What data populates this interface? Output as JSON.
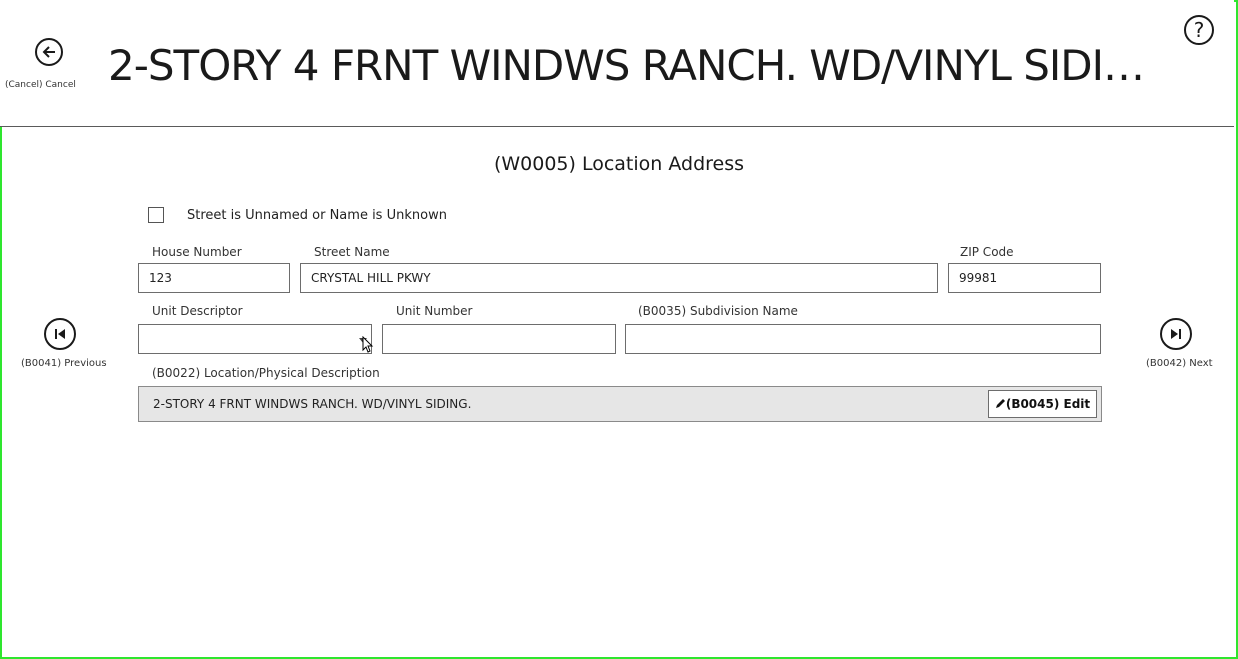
{
  "header": {
    "title": "2-STORY 4 FRNT WINDWS RANCH. WD/VINYL SIDI…",
    "cancel_label": "(Cancel) Cancel",
    "help_label": "?"
  },
  "form": {
    "section_title": "(W0005) Location Address",
    "unnamed_street": {
      "label": "Street is Unnamed or Name is Unknown",
      "checked": false
    },
    "house_number": {
      "label": "House Number",
      "value": "123"
    },
    "street_name": {
      "label": "Street Name",
      "value": "CRYSTAL HILL PKWY"
    },
    "zip_code": {
      "label": "ZIP Code",
      "value": "99981"
    },
    "unit_descriptor": {
      "label": "Unit Descriptor",
      "value": ""
    },
    "unit_number": {
      "label": "Unit Number",
      "value": ""
    },
    "subdivision_name": {
      "label": "(B0035) Subdivision Name",
      "value": ""
    },
    "location_description": {
      "label": "(B0022) Location/Physical Description",
      "value": "2-STORY 4 FRNT WINDWS RANCH. WD/VINYL SIDING.",
      "edit_label": "(B0045)  Edit"
    }
  },
  "nav": {
    "previous_label": "(B0041) Previous",
    "next_label": "(B0042) Next"
  },
  "colors": {
    "frame_border": "#2ee62e",
    "description_background": "#e6e6e6"
  }
}
